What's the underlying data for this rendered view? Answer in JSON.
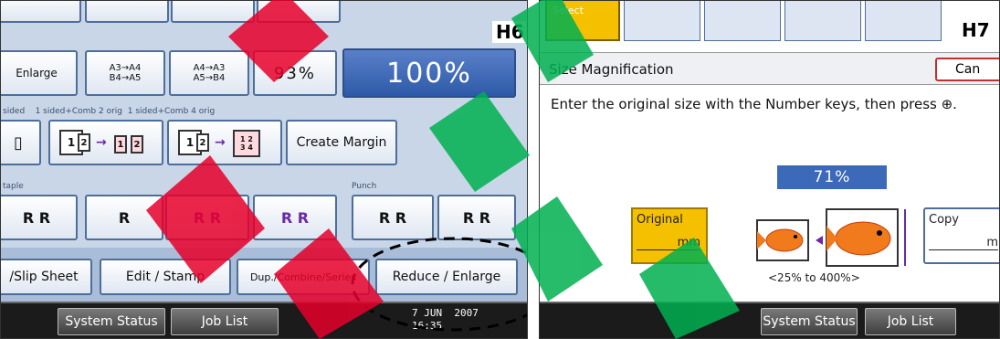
{
  "left_panel": {
    "tag": "H6",
    "ratio_buttons": [
      {
        "label": "Enlarge"
      },
      {
        "label": "A3→A4\nB4→A5"
      },
      {
        "label": "A4→A3\nA5→B4"
      },
      {
        "label": "93%"
      },
      {
        "label": "100%"
      }
    ],
    "combine_label": "sided    1 sided+Comb 2 orig  1 sided+Comb 4 orig",
    "create_margin": "Create Margin",
    "staple_label": "taple",
    "punch_label": "Punch",
    "tabs": [
      "/Slip Sheet",
      "Edit / Stamp",
      "Dup./Combine/Series",
      "Reduce / Enlarge"
    ],
    "bottom": {
      "system_status": "System Status",
      "job_list": "Job List",
      "date": "7 JUN  2007",
      "time": "16:35"
    }
  },
  "right_panel": {
    "tag": "H7",
    "select_tab": "Select",
    "title": "Size Magnification",
    "cancel": "Can",
    "instruction": "Enter the original size with the Number keys, then press ⊕.",
    "percent": "71%",
    "original_label": "Original",
    "original_unit": "mm",
    "copy_label": "Copy",
    "copy_unit": "m",
    "range": "<25% to 400%>",
    "bottom": {
      "system_status": "System Status",
      "job_list": "Job List"
    }
  },
  "colors": {
    "accent_blue": "#2d5aa8",
    "selected_yellow": "#f5c000",
    "watermark_red": "#e6002a",
    "watermark_green": "#00b050"
  }
}
